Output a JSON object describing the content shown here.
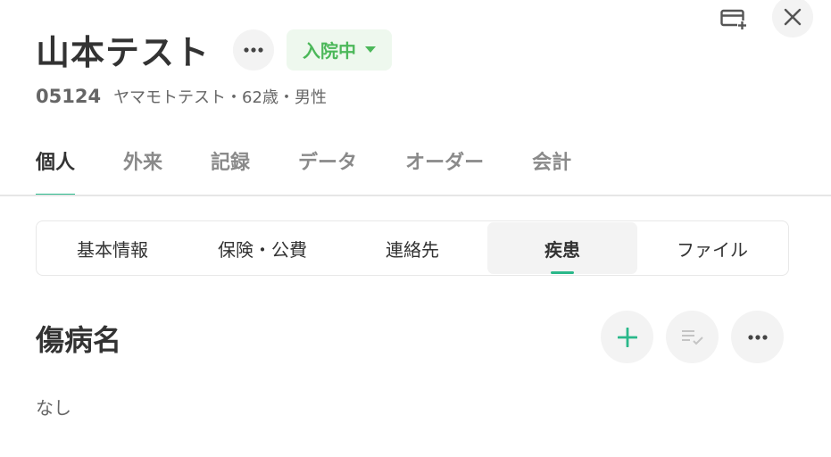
{
  "window": {
    "icons": [
      "card-add-icon",
      "close-icon"
    ]
  },
  "patient": {
    "name": "山本テスト",
    "status": "入院中",
    "id": "05124",
    "info": "ヤマモトテスト・62歳・男性"
  },
  "colors": {
    "accent": "#2ab88a",
    "status_text": "#4cb85a",
    "status_bg": "#eef8ee"
  },
  "main_tabs": [
    {
      "label": "個人",
      "active": true
    },
    {
      "label": "外来",
      "active": false
    },
    {
      "label": "記録",
      "active": false
    },
    {
      "label": "データ",
      "active": false
    },
    {
      "label": "オーダー",
      "active": false
    },
    {
      "label": "会計",
      "active": false
    }
  ],
  "sub_tabs": [
    {
      "label": "基本情報",
      "active": false
    },
    {
      "label": "保険・公費",
      "active": false
    },
    {
      "label": "連絡先",
      "active": false
    },
    {
      "label": "疾患",
      "active": true
    },
    {
      "label": "ファイル",
      "active": false
    }
  ],
  "section": {
    "title": "傷病名",
    "empty_text": "なし",
    "actions": [
      "add-icon",
      "list-check-icon",
      "more-icon"
    ]
  }
}
